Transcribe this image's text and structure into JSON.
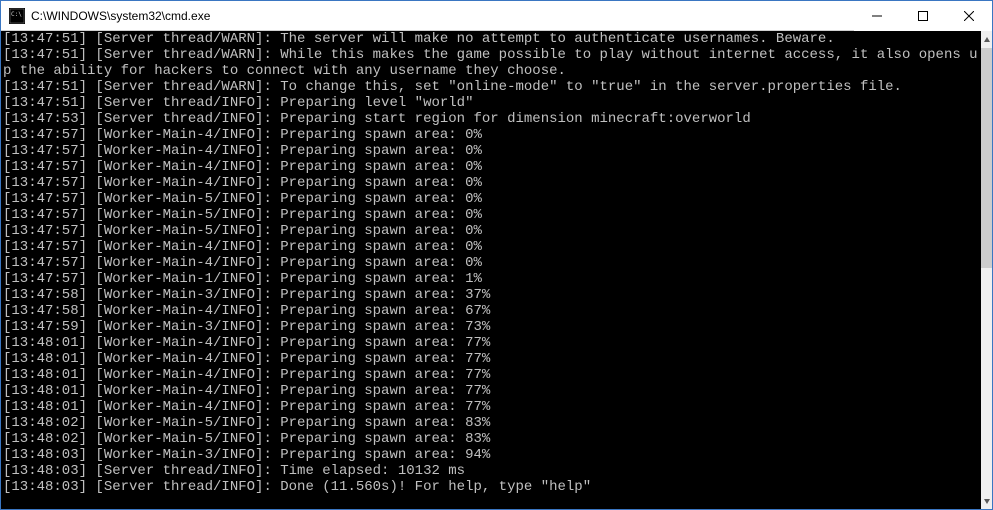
{
  "window": {
    "title": "C:\\WINDOWS\\system32\\cmd.exe"
  },
  "log_lines": [
    "[13:47:51] [Server thread/WARN]: The server will make no attempt to authenticate usernames. Beware.",
    "[13:47:51] [Server thread/WARN]: While this makes the game possible to play without internet access, it also opens up the ability for hackers to connect with any username they choose.",
    "[13:47:51] [Server thread/WARN]: To change this, set \"online-mode\" to \"true\" in the server.properties file.",
    "[13:47:51] [Server thread/INFO]: Preparing level \"world\"",
    "[13:47:53] [Server thread/INFO]: Preparing start region for dimension minecraft:overworld",
    "[13:47:57] [Worker-Main-4/INFO]: Preparing spawn area: 0%",
    "[13:47:57] [Worker-Main-4/INFO]: Preparing spawn area: 0%",
    "[13:47:57] [Worker-Main-4/INFO]: Preparing spawn area: 0%",
    "[13:47:57] [Worker-Main-4/INFO]: Preparing spawn area: 0%",
    "[13:47:57] [Worker-Main-5/INFO]: Preparing spawn area: 0%",
    "[13:47:57] [Worker-Main-5/INFO]: Preparing spawn area: 0%",
    "[13:47:57] [Worker-Main-5/INFO]: Preparing spawn area: 0%",
    "[13:47:57] [Worker-Main-4/INFO]: Preparing spawn area: 0%",
    "[13:47:57] [Worker-Main-4/INFO]: Preparing spawn area: 0%",
    "[13:47:57] [Worker-Main-1/INFO]: Preparing spawn area: 1%",
    "[13:47:58] [Worker-Main-3/INFO]: Preparing spawn area: 37%",
    "[13:47:58] [Worker-Main-4/INFO]: Preparing spawn area: 67%",
    "[13:47:59] [Worker-Main-3/INFO]: Preparing spawn area: 73%",
    "[13:48:01] [Worker-Main-4/INFO]: Preparing spawn area: 77%",
    "[13:48:01] [Worker-Main-4/INFO]: Preparing spawn area: 77%",
    "[13:48:01] [Worker-Main-4/INFO]: Preparing spawn area: 77%",
    "[13:48:01] [Worker-Main-4/INFO]: Preparing spawn area: 77%",
    "[13:48:01] [Worker-Main-4/INFO]: Preparing spawn area: 77%",
    "[13:48:02] [Worker-Main-5/INFO]: Preparing spawn area: 83%",
    "[13:48:02] [Worker-Main-5/INFO]: Preparing spawn area: 83%",
    "[13:48:03] [Worker-Main-3/INFO]: Preparing spawn area: 94%",
    "[13:48:03] [Server thread/INFO]: Time elapsed: 10132 ms",
    "[13:48:03] [Server thread/INFO]: Done (11.560s)! For help, type \"help\""
  ]
}
